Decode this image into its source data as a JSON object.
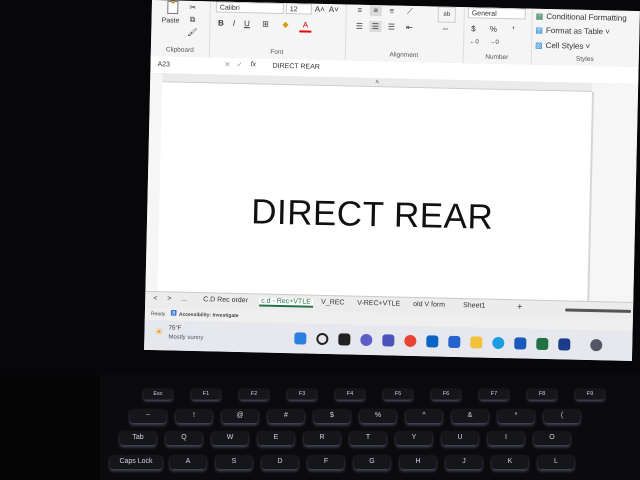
{
  "ribbon": {
    "paste_label": "Paste",
    "clipboard_label": "Clipboard",
    "font_name": "Calibri",
    "font_size": "12",
    "font_label": "Font",
    "alignment_label": "Alignment",
    "number_format": "General",
    "number_label": "Number",
    "conditional_formatting": "Conditional Formatting",
    "format_as_table": "Format as Table",
    "cell_styles": "Cell Styles",
    "styles_label": "Styles",
    "bold": "B",
    "italic": "I",
    "underline": "U",
    "grow_font": "A˄",
    "shrink_font": "A˅",
    "currency": "$",
    "percent": "%",
    "comma": "’",
    "wrap": "ab"
  },
  "formula_bar": {
    "name_box": "A23",
    "fx": "fx",
    "value": "DIRECT REAR"
  },
  "sheet": {
    "column_header": "A",
    "cell_text": "DIRECT REAR"
  },
  "tabs": {
    "nav_prev": "<",
    "nav_next": ">",
    "more": "...",
    "items": [
      "C.D Rec order",
      "c.d - Rec+VTLE",
      "V_REC",
      "V-REC+VTLE",
      "old V form",
      "Sheet1"
    ],
    "active_index": 1,
    "add": "+"
  },
  "status": {
    "ready": "Ready",
    "accessibility": "Accessibility: Investigate"
  },
  "taskbar": {
    "temperature": "75°F",
    "weather": "Mostly sunny"
  },
  "keyboard": {
    "row1": [
      "Esc",
      "F1",
      "F2",
      "F3",
      "F4",
      "F5",
      "F6",
      "F7",
      "F8",
      "F9"
    ],
    "row2": [
      "~",
      "!",
      "@",
      "#",
      "$",
      "%",
      "^",
      "&",
      "*",
      "("
    ],
    "row3": [
      "Tab",
      "Q",
      "W",
      "E",
      "R",
      "T",
      "Y",
      "U",
      "I",
      "O"
    ],
    "row4": [
      "Caps Lock",
      "A",
      "S",
      "D",
      "F",
      "G",
      "H",
      "J",
      "K",
      "L"
    ]
  },
  "colors": {
    "excel_green": "#217346",
    "accent_blue": "#0078d4"
  }
}
